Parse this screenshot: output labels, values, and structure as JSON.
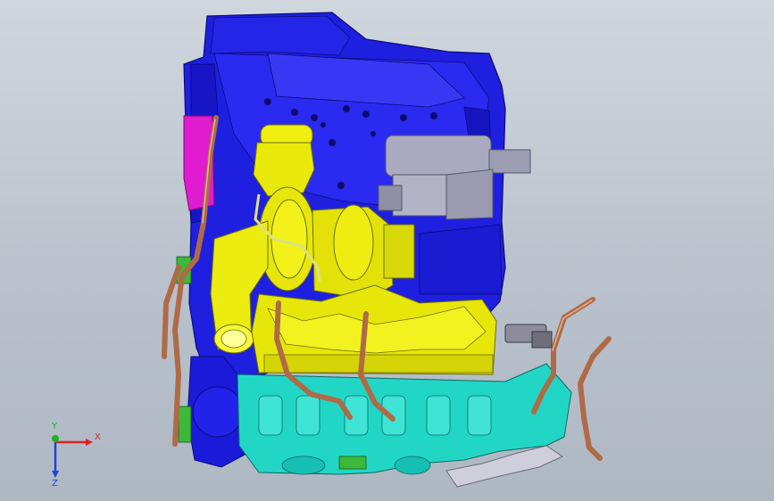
{
  "viewport": {
    "background_top": "#cfd6de",
    "background_bottom": "#aeb8c3"
  },
  "model": {
    "parts": [
      {
        "name": "engine-block",
        "color": "#1d1ee6"
      },
      {
        "name": "turbocharger-housing",
        "color": "#eaea0c"
      },
      {
        "name": "exhaust-manifold",
        "color": "#e8e80a"
      },
      {
        "name": "intake-manifold",
        "color": "#22d6c8"
      },
      {
        "name": "starter-motor",
        "color": "#a7a7bd"
      },
      {
        "name": "coolant-pipes",
        "color": "#b06a45"
      },
      {
        "name": "flywheel-cover",
        "color": "#e01bd0"
      },
      {
        "name": "oil-sump-flange",
        "color": "#3cb83a"
      }
    ]
  },
  "triad": {
    "x_label": "X",
    "y_label": "Y",
    "z_label": "Z",
    "x_color": "#e02020",
    "y_color": "#20b020",
    "z_color": "#2040e0"
  }
}
